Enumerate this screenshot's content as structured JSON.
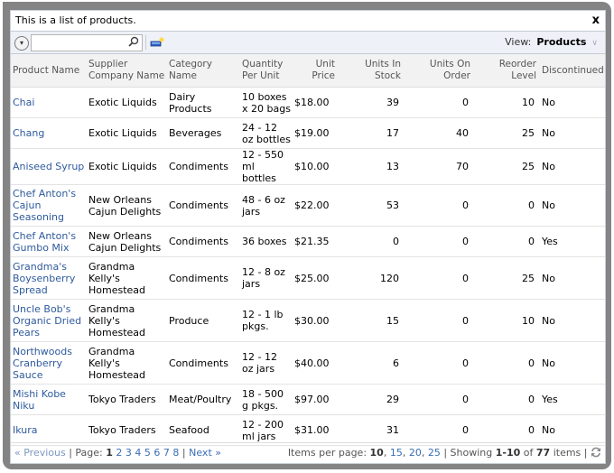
{
  "description": "This is a list of products.",
  "close_label": "x",
  "toolbar": {
    "search_value": "",
    "search_placeholder": "",
    "view_label": "View:",
    "view_value": "Products"
  },
  "columns": [
    "Product Name",
    "Supplier Company Name",
    "Category Name",
    "Quantity Per Unit",
    "Unit Price",
    "Units In Stock",
    "Units On Order",
    "Reorder Level",
    "Discontinued"
  ],
  "rows": [
    {
      "product": "Chai",
      "supplier": "Exotic Liquids",
      "category": "Dairy Products",
      "qty": "10 boxes x 20 bags",
      "price": "$18.00",
      "stock": "39",
      "order": "0",
      "reorder": "10",
      "disc": "No"
    },
    {
      "product": "Chang",
      "supplier": "Exotic Liquids",
      "category": "Beverages",
      "qty": "24 - 12 oz bottles",
      "price": "$19.00",
      "stock": "17",
      "order": "40",
      "reorder": "25",
      "disc": "No"
    },
    {
      "product": "Aniseed Syrup",
      "supplier": "Exotic Liquids",
      "category": "Condiments",
      "qty": "12 - 550 ml bottles",
      "price": "$10.00",
      "stock": "13",
      "order": "70",
      "reorder": "25",
      "disc": "No"
    },
    {
      "product": "Chef Anton's Cajun Seasoning",
      "supplier": "New Orleans Cajun Delights",
      "category": "Condiments",
      "qty": "48 - 6 oz jars",
      "price": "$22.00",
      "stock": "53",
      "order": "0",
      "reorder": "0",
      "disc": "No"
    },
    {
      "product": "Chef Anton's Gumbo Mix",
      "supplier": "New Orleans Cajun Delights",
      "category": "Condiments",
      "qty": "36 boxes",
      "price": "$21.35",
      "stock": "0",
      "order": "0",
      "reorder": "0",
      "disc": "Yes"
    },
    {
      "product": "Grandma's Boysenberry Spread",
      "supplier": "Grandma Kelly's Homestead",
      "category": "Condiments",
      "qty": "12 - 8 oz jars",
      "price": "$25.00",
      "stock": "120",
      "order": "0",
      "reorder": "25",
      "disc": "No"
    },
    {
      "product": "Uncle Bob's Organic Dried Pears",
      "supplier": "Grandma Kelly's Homestead",
      "category": "Produce",
      "qty": "12 - 1 lb pkgs.",
      "price": "$30.00",
      "stock": "15",
      "order": "0",
      "reorder": "10",
      "disc": "No"
    },
    {
      "product": "Northwoods Cranberry Sauce",
      "supplier": "Grandma Kelly's Homestead",
      "category": "Condiments",
      "qty": "12 - 12 oz jars",
      "price": "$40.00",
      "stock": "6",
      "order": "0",
      "reorder": "0",
      "disc": "No"
    },
    {
      "product": "Mishi Kobe Niku",
      "supplier": "Tokyo Traders",
      "category": "Meat/Poultry",
      "qty": "18 - 500 g pkgs.",
      "price": "$97.00",
      "stock": "29",
      "order": "0",
      "reorder": "0",
      "disc": "Yes"
    },
    {
      "product": "Ikura",
      "supplier": "Tokyo Traders",
      "category": "Seafood",
      "qty": "12 - 200 ml jars",
      "price": "$31.00",
      "stock": "31",
      "order": "0",
      "reorder": "0",
      "disc": "No"
    }
  ],
  "pager": {
    "previous": "« Previous",
    "page_label": "Page:",
    "pages": [
      "1",
      "2",
      "3",
      "4",
      "5",
      "6",
      "7",
      "8"
    ],
    "current_page": "1",
    "next": "Next »",
    "items_per_page_label": "Items per page:",
    "sizes": [
      "10",
      "15",
      "20",
      "25"
    ],
    "current_size": "10",
    "showing_label": "Showing",
    "range": "1-10",
    "of_label": "of",
    "total": "77",
    "items_label": "items"
  }
}
